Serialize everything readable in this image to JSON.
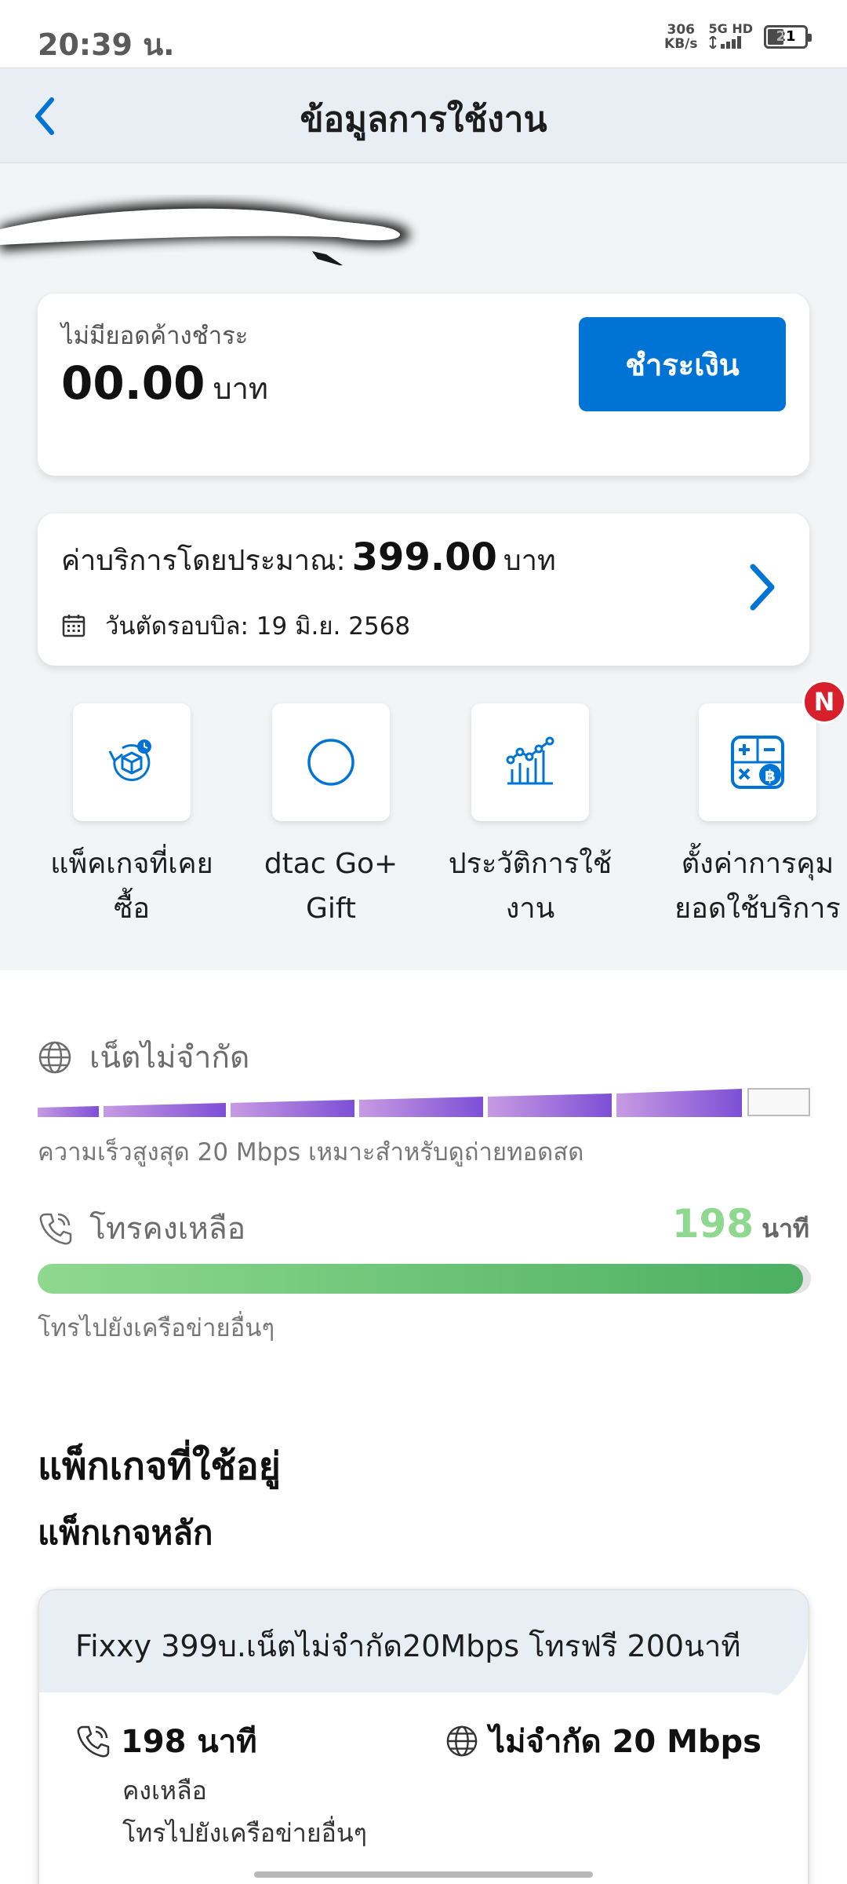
{
  "status_bar": {
    "time": "20:39 น.",
    "net_speed_value": "306",
    "net_speed_unit": "KB/s",
    "network_type": "5G HD",
    "battery_level": "21"
  },
  "header": {
    "title": "ข้อมูลการใช้งาน"
  },
  "balance": {
    "label": "ไม่มียอดค้างชำระ",
    "amount": "00.00",
    "unit": "บาท",
    "pay_label": "ชำระเงิน"
  },
  "estimate": {
    "label": "ค่าบริการโดยประมาณ:",
    "amount": "399.00",
    "unit": "บาท",
    "bill_cutoff": "วันตัดรอบบิล: 19 มิ.ย. 2568"
  },
  "quick_actions": [
    {
      "line1": "แพ็คเกจที่เคย",
      "line2": "ซื้อ",
      "icon": "package-history-icon"
    },
    {
      "line1": "dtac Go+",
      "line2": "Gift",
      "icon": "circle-icon"
    },
    {
      "line1": "ประวัติการใช้",
      "line2": "งาน",
      "icon": "chart-icon"
    },
    {
      "line1": "ตั้งค่าการคุม",
      "line2": "ยอดใช้บริการ",
      "icon": "calculator-baht-icon",
      "badge": "N"
    }
  ],
  "internet": {
    "title": "เน็ตไม่จำกัด",
    "description": "ความเร็วสูงสุด 20 Mbps เหมาะสำหรับดูถ่ายทอดสด"
  },
  "calls": {
    "title": "โทรคงเหลือ",
    "remaining": "198",
    "unit": "นาที",
    "fill_fraction": 0.99,
    "description": "โทรไปยังเครือข่ายอื่นๆ"
  },
  "packages": {
    "section_title": "แพ็กเกจที่ใช้อยู่",
    "main_title": "แพ็กเกจหลัก",
    "main_package": {
      "name": "Fixxy 399บ.เน็ตไม่จำกัด20Mbps โทรฟรี 200นาที",
      "call_value": "198 นาที",
      "call_sub1": "คงเหลือ",
      "call_sub2": "โทรไปยังเครือข่ายอื่นๆ",
      "data_value": "ไม่จำกัด 20 Mbps"
    }
  },
  "colors": {
    "primary_blue": "#0074d4",
    "call_green": "#8fd88f",
    "data_purple": "#8a55d6",
    "badge_red": "#d8202c"
  }
}
